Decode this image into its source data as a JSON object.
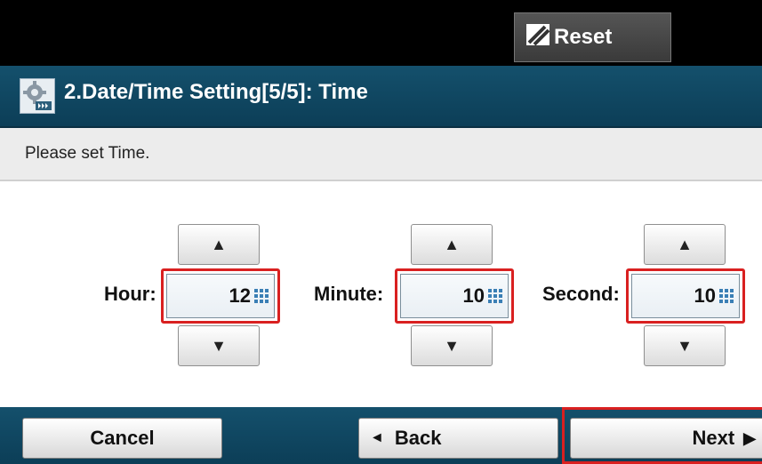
{
  "header": {
    "reset_label": "Reset",
    "reset_icon": "reset-slash-icon"
  },
  "title_bar": {
    "title": "2.Date/Time Setting[5/5]: Time",
    "icon": "settings-gear-icon"
  },
  "instruction": "Please set Time.",
  "fields": [
    {
      "label": "Hour:",
      "value": "12"
    },
    {
      "label": "Minute:",
      "value": "10"
    },
    {
      "label": "Second:",
      "value": "10"
    }
  ],
  "steppers": {
    "up_symbol": "▲",
    "down_symbol": "▼"
  },
  "footer": {
    "cancel_label": "Cancel",
    "back_label": "Back",
    "back_symbol": "◄",
    "next_label": "Next",
    "next_symbol": "▶"
  },
  "colors": {
    "title_bar": "#14506c",
    "highlight": "#d92020",
    "top_bar": "#000000"
  }
}
